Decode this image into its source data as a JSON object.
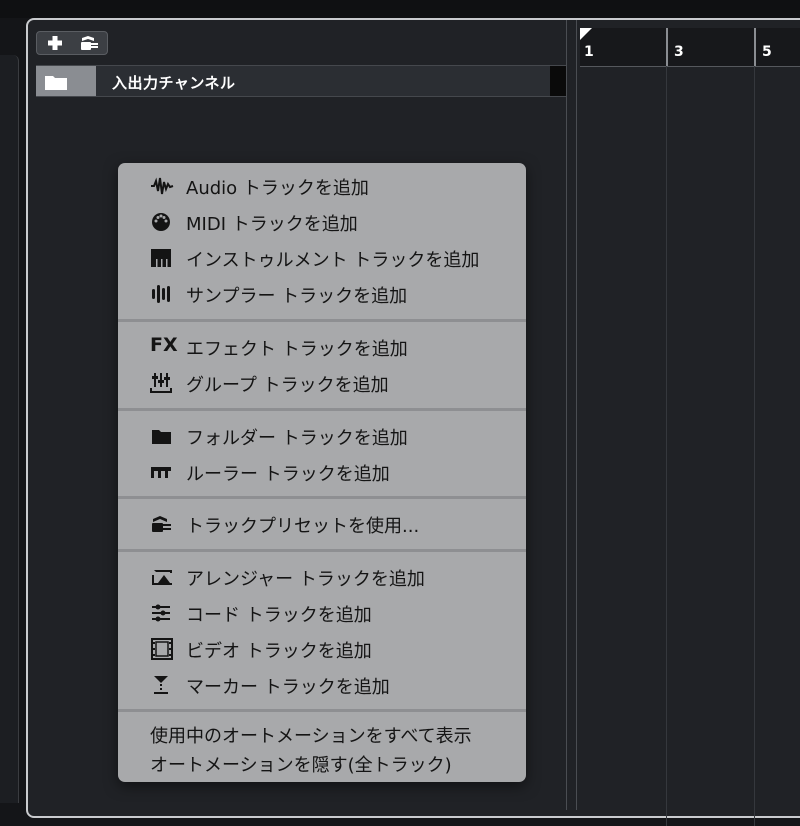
{
  "toolbar": {
    "add_icon": "plus-icon",
    "preset_icon": "track-preset-icon"
  },
  "track": {
    "name": "入出力チャンネル",
    "icon": "folder-icon"
  },
  "ruler": {
    "marks": [
      "1",
      "3",
      "5"
    ]
  },
  "menu": {
    "groups": [
      {
        "items": [
          {
            "icon": "audio-waveform-icon",
            "label": "Audio トラックを追加"
          },
          {
            "icon": "midi-connector-icon",
            "label": "MIDI トラックを追加"
          },
          {
            "icon": "piano-keys-icon",
            "label": "インストゥルメント トラックを追加"
          },
          {
            "icon": "sampler-icon",
            "label": "サンプラー トラックを追加"
          }
        ]
      },
      {
        "items": [
          {
            "icon": "fx-icon",
            "label": "エフェクト トラックを追加",
            "icon_text": "FX"
          },
          {
            "icon": "group-faders-icon",
            "label": "グループ トラックを追加"
          }
        ]
      },
      {
        "items": [
          {
            "icon": "folder-icon",
            "label": "フォルダー トラックを追加"
          },
          {
            "icon": "ruler-icon",
            "label": "ルーラー トラックを追加"
          }
        ]
      },
      {
        "items": [
          {
            "icon": "track-preset-icon",
            "label": "トラックプリセットを使用..."
          }
        ]
      },
      {
        "items": [
          {
            "icon": "arranger-icon",
            "label": "アレンジャー トラックを追加"
          },
          {
            "icon": "chord-icon",
            "label": "コード トラックを追加"
          },
          {
            "icon": "video-film-icon",
            "label": "ビデオ トラックを追加"
          },
          {
            "icon": "marker-icon",
            "label": "マーカー トラックを追加"
          }
        ]
      },
      {
        "items": [
          {
            "label": "使用中のオートメーションをすべて表示"
          },
          {
            "label": "オートメーションを隠す(全トラック)"
          }
        ]
      }
    ]
  }
}
